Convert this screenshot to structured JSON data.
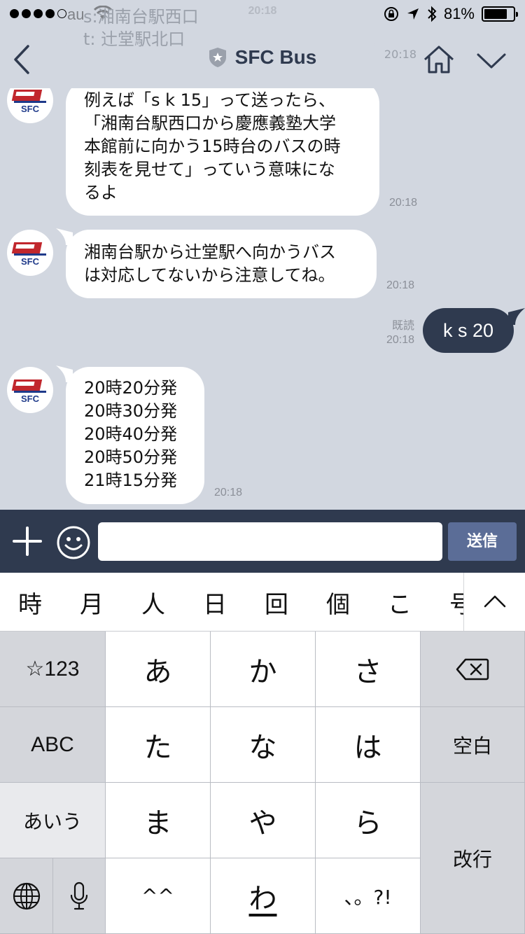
{
  "status_bar": {
    "carrier": "au",
    "time": "20:18",
    "battery": "81%",
    "battery_level": 0.81,
    "signal_bars": 4
  },
  "ghost_notification": {
    "line1": "s:湘南台駅西口",
    "line2": "t: 辻堂駅北口",
    "time": "20:18"
  },
  "header": {
    "title": "SFC Bus"
  },
  "messages": [
    {
      "from": "bot",
      "lines": [
        "例えば「s k 15」って送ったら、",
        "「湘南台駅西口から慶應義塾大学",
        "本館前に向かう15時台のバスの時",
        "刻表を見せて」っていう意味にな",
        "るよ"
      ],
      "time": "20:18"
    },
    {
      "from": "bot",
      "lines": [
        "湘南台駅から辻堂駅へ向かうバス",
        "は対応してないから注意してね。"
      ],
      "time": "20:18"
    },
    {
      "from": "me",
      "text": "k s 20",
      "read": "既読",
      "time": "20:18"
    },
    {
      "from": "bot",
      "lines": [
        "20時20分発",
        "20時30分発",
        "20時40分発",
        "20時50分発",
        "21時15分発"
      ],
      "time": "20:18"
    }
  ],
  "input_bar": {
    "placeholder": "",
    "send_label": "送信"
  },
  "suggestions": [
    "時",
    "月",
    "人",
    "日",
    "回",
    "個",
    "こ",
    "号"
  ],
  "keyboard": {
    "row1": [
      "☆123",
      "あ",
      "か",
      "さ"
    ],
    "row2": [
      "ABC",
      "た",
      "な",
      "は",
      "空白"
    ],
    "row3": [
      "あいう",
      "ま",
      "や",
      "ら",
      "改行"
    ],
    "row4": [
      "^^",
      "わ",
      "、。?!"
    ]
  },
  "colors": {
    "chat_bg": "#d2d7e0",
    "header_text": "#2f3a4f",
    "my_bubble": "#2f3a4f",
    "input_bar": "#2f3a4f",
    "send_button": "#5b6d97"
  }
}
